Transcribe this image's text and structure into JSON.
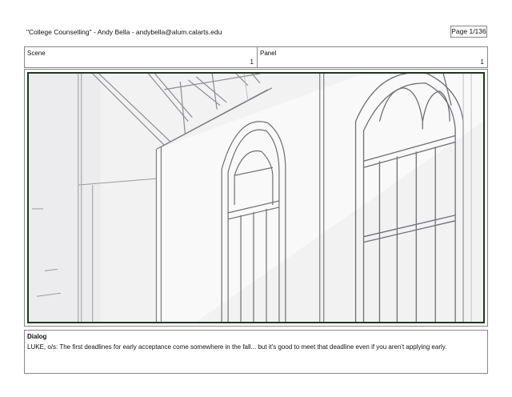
{
  "header": {
    "title": "\"College Counselling\"  -  Andy Bella  -   andybella@alum.calarts.edu",
    "page": "Page   1/136"
  },
  "scene": {
    "label": "Scene",
    "number": "1"
  },
  "panel": {
    "label": "Panel",
    "number": "1"
  },
  "dialog": {
    "heading": "Dialog",
    "text": "LUKE, o/s: The first deadlines for early acceptance come somewhere in the fall... but it's good to meet that deadline even if you aren't applying early."
  }
}
